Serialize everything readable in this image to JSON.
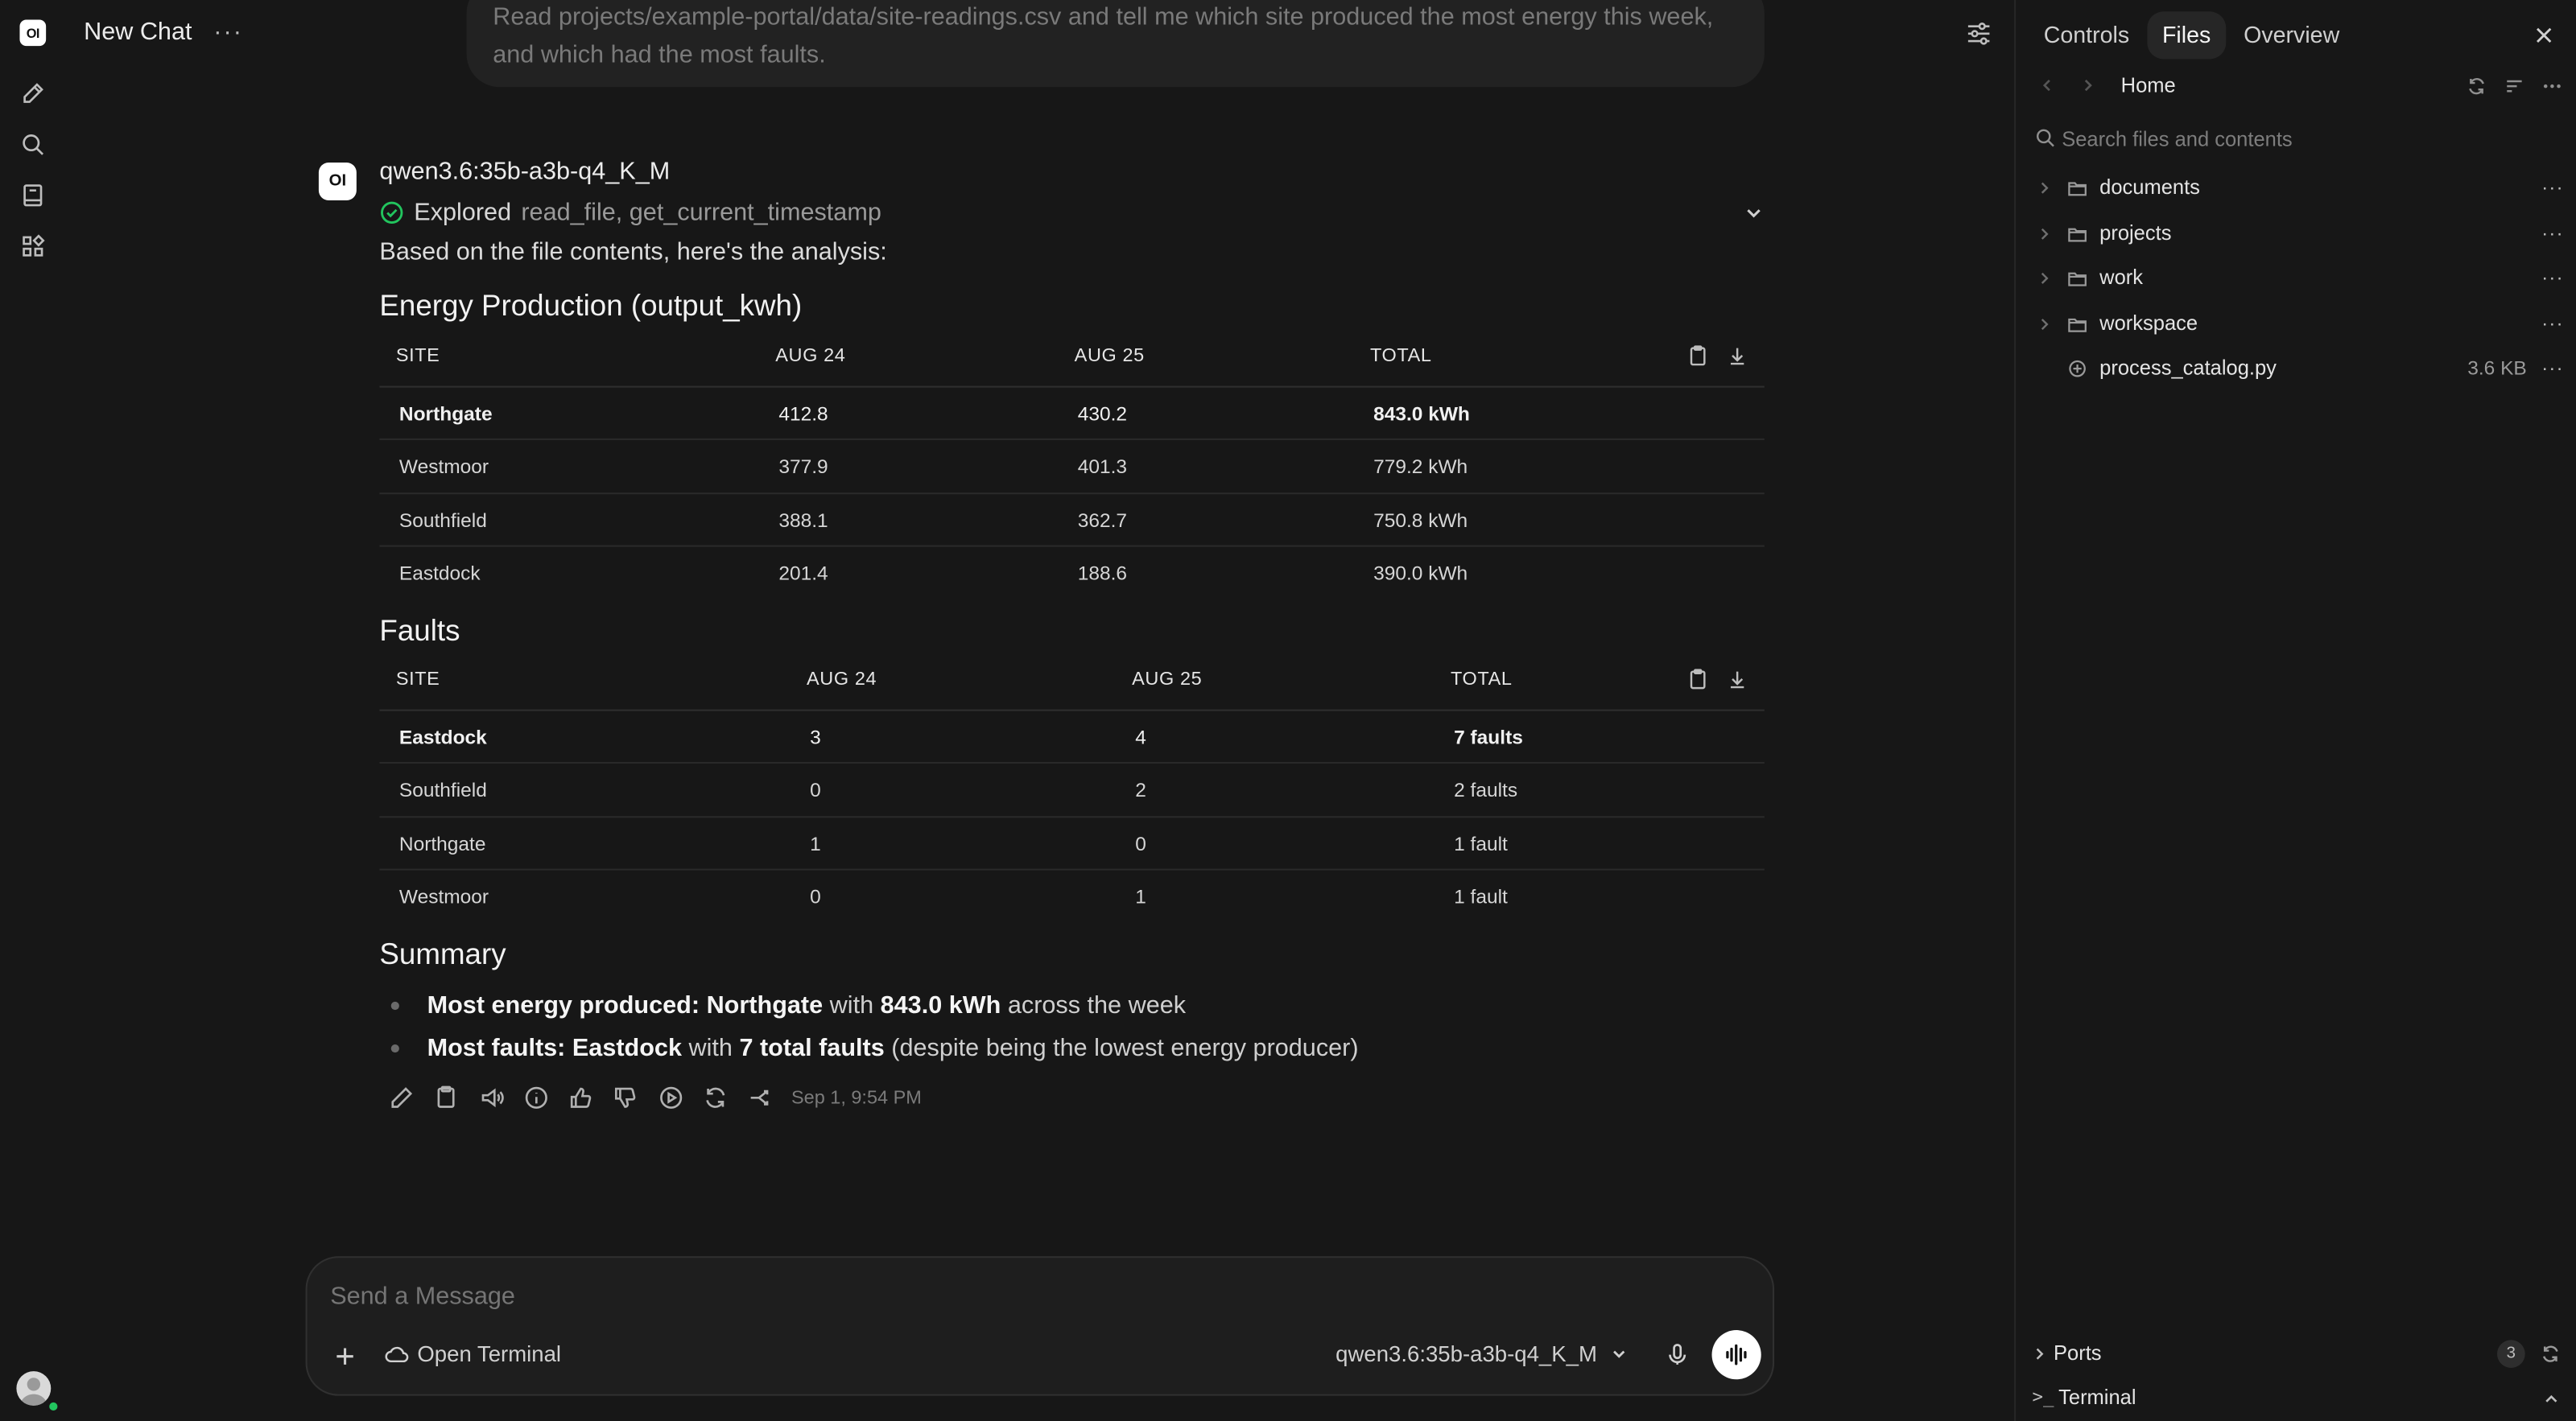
{
  "app": {
    "logo_text": "OI"
  },
  "header": {
    "title": "New Chat",
    "more_glyph": "···"
  },
  "user_message": "Read projects/example-portal/data/site-readings.csv and tell me which site produced the most energy this week, and which had the most faults.",
  "assistant": {
    "avatar_text": "OI",
    "model": "qwen3.6:35b-a3b-q4_K_M",
    "explored_label": "Explored",
    "explored_tools": "read_file, get_current_timestamp",
    "intro": "Based on the file contents, here's the analysis:",
    "energy_heading": "Energy Production (output_kwh)",
    "energy_table": {
      "headers": [
        "SITE",
        "AUG 24",
        "AUG 25",
        "TOTAL"
      ],
      "rows": [
        [
          "Northgate",
          "412.8",
          "430.2",
          "843.0 kWh"
        ],
        [
          "Westmoor",
          "377.9",
          "401.3",
          "779.2 kWh"
        ],
        [
          "Southfield",
          "388.1",
          "362.7",
          "750.8 kWh"
        ],
        [
          "Eastdock",
          "201.4",
          "188.6",
          "390.0 kWh"
        ]
      ]
    },
    "faults_heading": "Faults",
    "faults_table": {
      "headers": [
        "SITE",
        "AUG 24",
        "AUG 25",
        "TOTAL"
      ],
      "rows": [
        [
          "Eastdock",
          "3",
          "4",
          "7 faults"
        ],
        [
          "Southfield",
          "0",
          "2",
          "2 faults"
        ],
        [
          "Northgate",
          "1",
          "0",
          "1 fault"
        ],
        [
          "Westmoor",
          "0",
          "1",
          "1 fault"
        ]
      ]
    },
    "summary_heading": "Summary",
    "summary": [
      {
        "b1": "Most energy produced: Northgate",
        "t1": " with ",
        "b2": "843.0 kWh",
        "t2": " across the week"
      },
      {
        "b1": "Most faults: Eastdock",
        "t1": " with ",
        "b2": "7 total faults",
        "t2": " (despite being the lowest energy producer)"
      }
    ],
    "timestamp": "Sep 1, 9:54 PM"
  },
  "composer": {
    "placeholder": "Send a Message",
    "terminal_label": "Open Terminal",
    "model_label": "qwen3.6:35b-a3b-q4_K_M"
  },
  "panel": {
    "tabs": [
      "Controls",
      "Files",
      "Overview"
    ],
    "active_tab": "Files",
    "breadcrumb": "Home",
    "search_placeholder": "Search files and contents",
    "tree": [
      {
        "name": "documents",
        "type": "folder"
      },
      {
        "name": "projects",
        "type": "folder"
      },
      {
        "name": "work",
        "type": "folder"
      },
      {
        "name": "workspace",
        "type": "folder"
      },
      {
        "name": "process_catalog.py",
        "type": "file",
        "size": "3.6 KB"
      }
    ],
    "ports_label": "Ports",
    "ports_count": "3",
    "terminal_label": "Terminal"
  }
}
